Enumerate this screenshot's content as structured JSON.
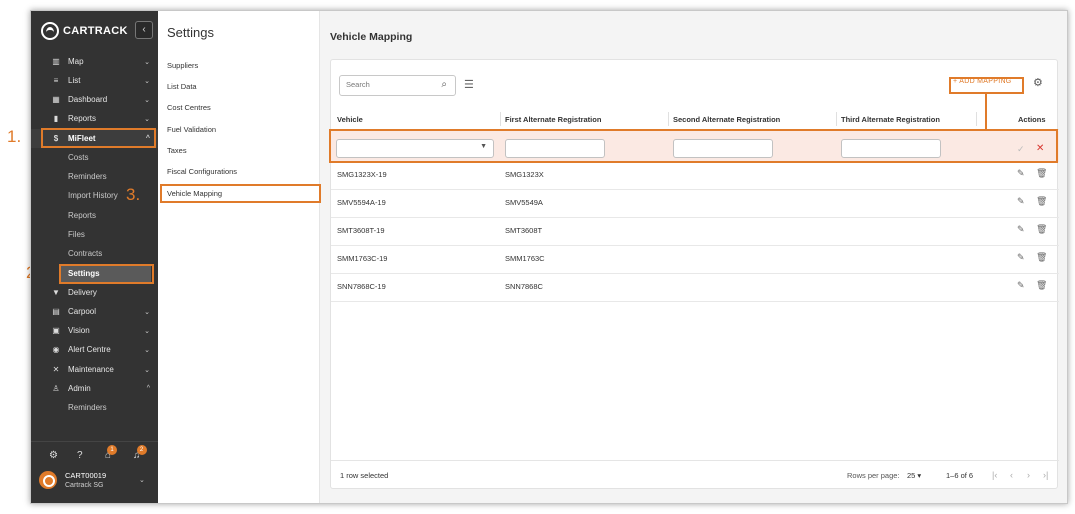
{
  "nav": {
    "brand": "CARTRACK",
    "collapse_icon": "chevron-left-icon",
    "items": [
      {
        "label": "Map",
        "icon": "map-icon",
        "chev": "⌄"
      },
      {
        "label": "List",
        "icon": "list-icon",
        "chev": "⌄"
      },
      {
        "label": "Dashboard",
        "icon": "dashboard-icon",
        "chev": "⌄"
      },
      {
        "label": "Reports",
        "icon": "chart-icon",
        "chev": "⌄"
      },
      {
        "label": "MiFleet",
        "icon": "dollar-icon",
        "chev": "^"
      },
      {
        "label": "Delivery",
        "icon": "delivery-icon",
        "chev": ""
      },
      {
        "label": "Carpool",
        "icon": "calendar-icon",
        "chev": "⌄"
      },
      {
        "label": "Vision",
        "icon": "video-icon",
        "chev": "⌄"
      },
      {
        "label": "Alert Centre",
        "icon": "alert-icon",
        "chev": "⌄"
      },
      {
        "label": "Maintenance",
        "icon": "wrench-icon",
        "chev": "⌄"
      },
      {
        "label": "Admin",
        "icon": "admin-icon",
        "chev": "^"
      }
    ],
    "mifleet_sub": [
      "Costs",
      "Reminders",
      "Import History",
      "Reports",
      "Files",
      "Contracts",
      "Settings"
    ],
    "admin_sub": [
      "Reminders"
    ],
    "bottom_badges": [
      "1",
      "2"
    ],
    "user_id": "CART00019",
    "user_company": "Cartrack SG"
  },
  "settings": {
    "title": "Settings",
    "items": [
      "Suppliers",
      "List Data",
      "Cost Centres",
      "Fuel Validation",
      "Taxes",
      "Fiscal Configurations",
      "Vehicle Mapping"
    ]
  },
  "main": {
    "title": "Vehicle Mapping",
    "search_placeholder": "Search",
    "add_mapping": "+ ADD MAPPING",
    "columns": [
      "Vehicle",
      "First Alternate Registration",
      "Second Alternate Registration",
      "Third Alternate Registration",
      "Actions"
    ],
    "rows": [
      {
        "vehicle": "SMG1323X-19",
        "first": "SMG1323X"
      },
      {
        "vehicle": "SMV5594A-19",
        "first": "SMV5549A"
      },
      {
        "vehicle": "SMT3608T-19",
        "first": "SMT3608T"
      },
      {
        "vehicle": "SMM1763C-19",
        "first": "SMM1763C"
      },
      {
        "vehicle": "SNN7868C-19",
        "first": "SNN7868C"
      }
    ],
    "footer": {
      "selected": "1 row selected",
      "rows_per_page_label": "Rows per page:",
      "rows_per_page_value": "25 ▾",
      "range": "1–6 of 6"
    }
  },
  "annotations": {
    "one": "1.",
    "two": "2.",
    "three": "3."
  },
  "colors": {
    "accent": "#e07b2a",
    "nav_bg": "#333333",
    "edit_row_bg": "#fbe9e3",
    "cancel_red": "#d9362f"
  }
}
